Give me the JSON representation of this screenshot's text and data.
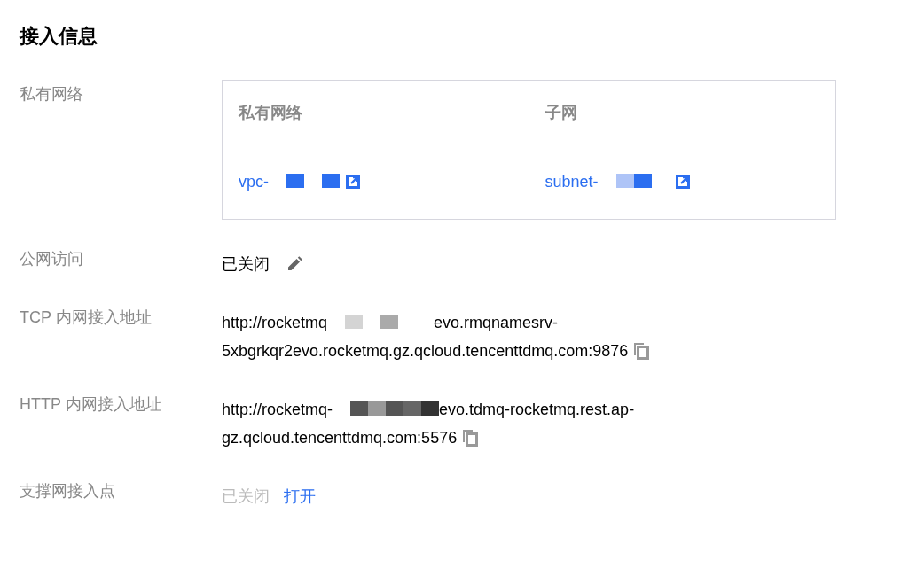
{
  "title": "接入信息",
  "rows": [
    {
      "kind": "table",
      "label": "私有网络",
      "columns": [
        "私有网络",
        "子网"
      ],
      "cells": [
        {
          "text": "vpc-"
        },
        {
          "text": "subnet-"
        }
      ]
    },
    {
      "kind": "status",
      "label": "公网访问",
      "value": "已关闭"
    },
    {
      "kind": "address",
      "label": "TCP 内网接入地址",
      "prefix": "http://rocketmq",
      "suffix": "evo.rmqnamesrv-",
      "line2": "5xbgrkqr2evo.rocketmq.gz.qcloud.tencenttdmq.com:9876"
    },
    {
      "kind": "address",
      "label": "HTTP 内网接入地址",
      "prefix": "http://rocketmq-",
      "suffix": "evo.tdmq-rocketmq.rest.ap-",
      "line2": "gz.qcloud.tencenttdmq.com:5576"
    },
    {
      "kind": "toggle",
      "label": "支撑网接入点",
      "value": "已关闭",
      "action": "打开"
    }
  ]
}
